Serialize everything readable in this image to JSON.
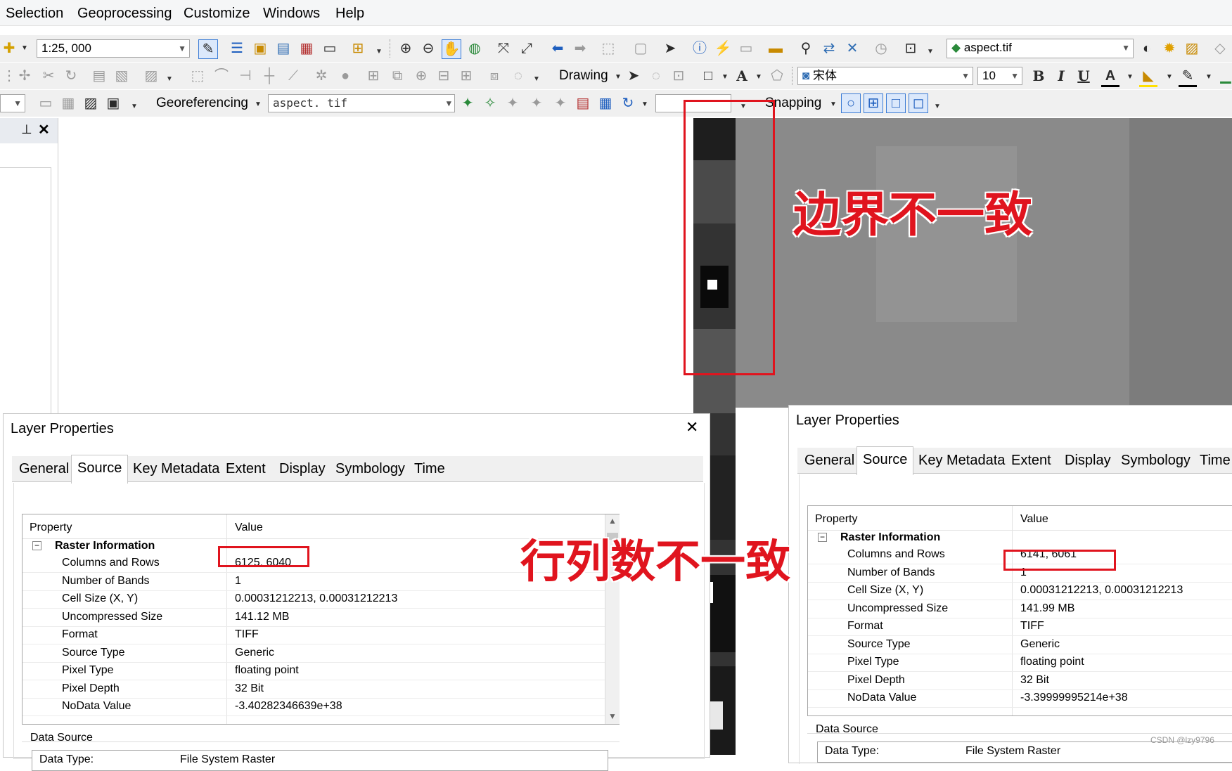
{
  "menubar": {
    "items": [
      "Selection",
      "Geoprocessing",
      "Customize",
      "Windows",
      "Help"
    ]
  },
  "toolbar1": {
    "scale_value": "1:25, 000",
    "layer_combo": "aspect.tif"
  },
  "toolbar2": {
    "drawing_label": "Drawing",
    "font_name": "宋体",
    "font_size": "10",
    "bold": "B",
    "italic": "I",
    "underline": "U",
    "font_color": "A"
  },
  "toolbar3": {
    "georef_label": "Georeferencing",
    "georef_layer": "aspect. tif",
    "snapping_label": "Snapping"
  },
  "annotations": {
    "boundary": "边界不一致",
    "rowcol": "行列数不一致"
  },
  "dialog_left": {
    "title": "Layer Properties",
    "tabs": [
      "General",
      "Source",
      "Key Metadata",
      "Extent",
      "Display",
      "Symbology",
      "Time"
    ],
    "header_property": "Property",
    "header_value": "Value",
    "section": "Raster Information",
    "rows": [
      {
        "k": "Columns and Rows",
        "v": "6125, 6040"
      },
      {
        "k": "Number of Bands",
        "v": "1"
      },
      {
        "k": "Cell Size (X, Y)",
        "v": "0.00031212213, 0.00031212213"
      },
      {
        "k": "Uncompressed Size",
        "v": "141.12 MB"
      },
      {
        "k": "Format",
        "v": "TIFF"
      },
      {
        "k": "Source Type",
        "v": "Generic"
      },
      {
        "k": "Pixel Type",
        "v": "floating point"
      },
      {
        "k": "Pixel Depth",
        "v": "32 Bit"
      },
      {
        "k": "NoData Value",
        "v": "-3.40282346639e+38"
      }
    ],
    "data_source": "Data Source",
    "data_type_label": "Data Type:",
    "data_type_value": "File System Raster"
  },
  "dialog_right": {
    "title": "Layer Properties",
    "tabs": [
      "General",
      "Source",
      "Key Metadata",
      "Extent",
      "Display",
      "Symbology",
      "Time"
    ],
    "header_property": "Property",
    "header_value": "Value",
    "section": "Raster Information",
    "rows": [
      {
        "k": "Columns and Rows",
        "v": "6141, 6061"
      },
      {
        "k": "Number of Bands",
        "v": "1"
      },
      {
        "k": "Cell Size (X, Y)",
        "v": "0.00031212213, 0.00031212213"
      },
      {
        "k": "Uncompressed Size",
        "v": "141.99 MB"
      },
      {
        "k": "Format",
        "v": "TIFF"
      },
      {
        "k": "Source Type",
        "v": "Generic"
      },
      {
        "k": "Pixel Type",
        "v": "floating point"
      },
      {
        "k": "Pixel Depth",
        "v": "32 Bit"
      },
      {
        "k": "NoData Value",
        "v": "-3.39999995214e+38"
      }
    ],
    "data_source": "Data Source",
    "data_type_label": "Data Type:",
    "data_type_value": "File System Raster"
  },
  "watermark": "CSDN @lzy9796",
  "colors": {
    "annotation_red": "#e0141e",
    "map_grey": "#8a8a8a"
  }
}
